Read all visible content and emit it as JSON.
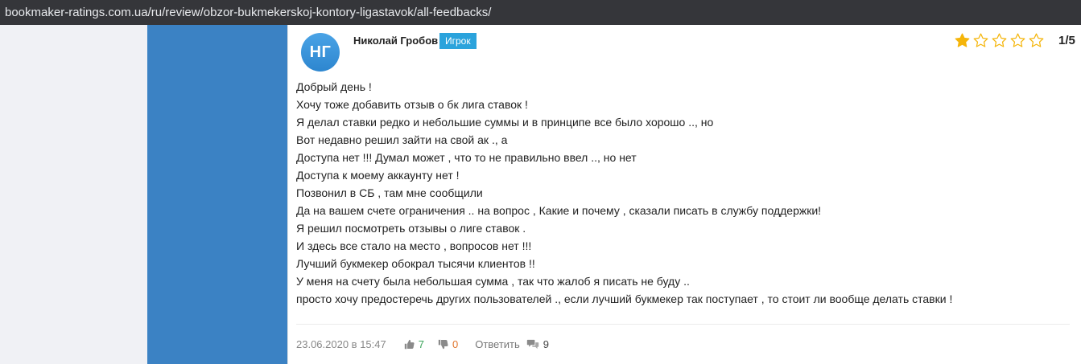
{
  "browser": {
    "url": "bookmaker-ratings.com.ua/ru/review/obzor-bukmekerskoj-kontory-ligastavok/all-feedbacks/"
  },
  "review": {
    "avatar_initials": "НГ",
    "author": "Николай Гробов",
    "role": "Игрок",
    "rating": {
      "value": 1,
      "max": 5,
      "label": "1/5"
    },
    "lines": [
      "Добрый день !",
      "Хочу тоже добавить отзыв о бк лига ставок !",
      "Я делал ставки редко и небольшие суммы и в принципе все было хорошо .., но",
      "Вот недавно решил зайти на свой ак ., а",
      "Доступа нет !!! Думал может , что то не правильно ввел .., но нет",
      "Доступа к моему аккаунту нет !",
      "Позвонил в СБ , там мне сообщили",
      "Да на вашем счете ограничения .. на вопрос , Какие и почему , сказали писать в службу поддержки!",
      "Я решил посмотреть отзывы о лиге ставок .",
      "И здесь все стало на место , вопросов нет !!!",
      "Лучший букмекер обокрал тысячи клиентов !!",
      "У меня на счету была небольшая сумма , так что жалоб я писать не буду ..",
      "просто хочу предостеречь других пользователей ., если лучший букмекер так поступает , то стоит ли вообще делать ставки !"
    ],
    "date": "23.06.2020 в 15:47",
    "likes": "7",
    "dislikes": "0",
    "reply_label": "Ответить",
    "comments": "9"
  },
  "colors": {
    "star_filled": "#f5b50a",
    "star_empty_stroke": "#f5b50a",
    "badge": "#2ba3dc",
    "sidebar_blue": "#3b82c4",
    "like": "#3aa35a",
    "dislike": "#e0752d"
  },
  "icons": {
    "like": "thumbs-up-icon",
    "dislike": "thumbs-down-icon",
    "comments": "speech-bubbles-icon",
    "star": "star-icon"
  }
}
